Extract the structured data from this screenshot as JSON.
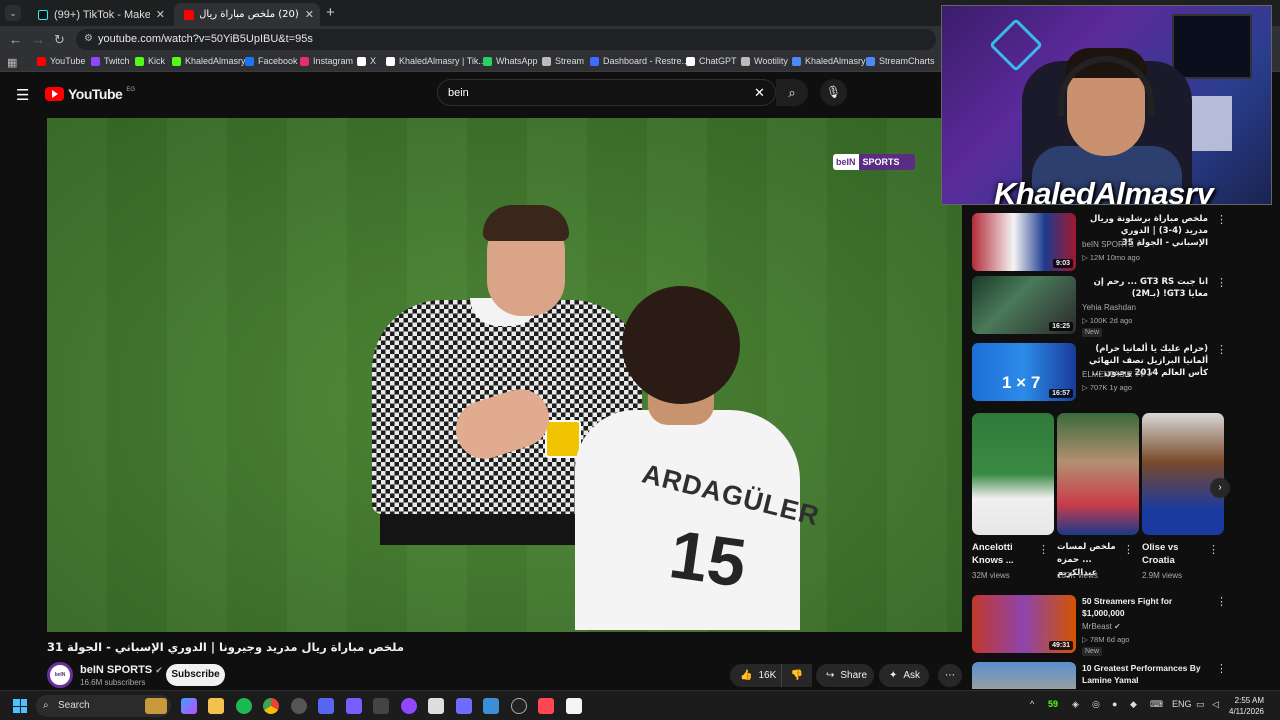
{
  "browser": {
    "tabs": [
      {
        "title": "(99+) TikTok - Make Your Day",
        "icon": "tiktok-icon"
      },
      {
        "title": "(20) ملخص مباراة ريال مدريد و",
        "icon": "youtube-icon"
      }
    ],
    "url": "youtube.com/watch?v=50YiB5UpIBU&t=95s",
    "bookmarks": [
      {
        "label": "YouTube",
        "color": "#ff0000"
      },
      {
        "label": "Twitch",
        "color": "#9146ff"
      },
      {
        "label": "Kick",
        "color": "#53fc18"
      },
      {
        "label": "KhaledAlmasry",
        "color": "#53fc18"
      },
      {
        "label": "Facebook",
        "color": "#1877f2"
      },
      {
        "label": "Instagram",
        "color": "#e1306c"
      },
      {
        "label": "X",
        "color": "#ffffff"
      },
      {
        "label": "KhaledAlmasry | Tik...",
        "color": "#ffffff"
      },
      {
        "label": "WhatsApp",
        "color": "#25d366"
      },
      {
        "label": "Stream",
        "color": "#bbbbbb"
      },
      {
        "label": "Dashboard - Restre...",
        "color": "#3d6bff"
      },
      {
        "label": "ChatGPT",
        "color": "#ffffff"
      },
      {
        "label": "Wootility",
        "color": "#bbbbbb"
      },
      {
        "label": "KhaledAlmasry",
        "color": "#4c8bf5"
      },
      {
        "label": "StreamCharts",
        "color": "#4c8bf5"
      }
    ]
  },
  "youtube": {
    "logo_text": "YouTube",
    "region": "EG",
    "search_query": "bein",
    "video": {
      "title": "ملخص مباراة ريال مدريد وجيرونا | الدوري الإسباني - الجولة 31",
      "overlay_logo": {
        "part1": "beIN",
        "part2": "SPORTS"
      },
      "player_name": "ARDAGÜLER",
      "player_number": "15"
    },
    "channel": {
      "name": "beIN SPORTS",
      "subscribers": "16.6M subscribers",
      "avatar_text": "beIN SPORTS"
    },
    "actions": {
      "subscribe": "Subscribe",
      "likes": "16K",
      "share": "Share",
      "ask": "Ask"
    },
    "recommendations": [
      {
        "title": "ملخص مباراة برشلونة وريال مدريد (4-3) | الدوري الإسباني - الجولة 35",
        "channel": "beIN SPORTS",
        "meta": "▷ 12M  10mo ago",
        "duration": "9:03",
        "verified": true,
        "new": false,
        "rtl": true
      },
      {
        "title": "انا جبت GT3 RS ... رحم إن معايا GT3! (بـ2M)",
        "channel": "Yehia Rashdan",
        "meta": "▷ 100K  2d ago",
        "duration": "16:25",
        "verified": false,
        "new": true,
        "rtl": true
      },
      {
        "title": "(حرام عليك يا ألمانيا حرام) ألمانيا البرازيل نصف النهائي كأس العالم 2014 وجنون ...",
        "channel": "ELMENTASIR TV",
        "meta": "▷ 707K  1y ago",
        "duration": "16:57",
        "verified": true,
        "new": false,
        "rtl": true
      }
    ],
    "shorts": [
      {
        "title": "Ancelotti Knows ...",
        "views": "32M views"
      },
      {
        "title": "ملخص لمسات ... حمزه عبدالكريم",
        "views": "103K views"
      },
      {
        "title": "Olise vs Croatia",
        "views": "2.9M views"
      }
    ],
    "more_recs": [
      {
        "title": "50 Streamers Fight for $1,000,000",
        "channel": "MrBeast",
        "meta": "▷ 78M  6d ago",
        "duration": "49:31",
        "verified": true,
        "new": true
      },
      {
        "title": "10 Greatest Performances By Lamine Yamal",
        "channel": "",
        "meta": "",
        "duration": "",
        "verified": false,
        "new": false
      }
    ],
    "new_badge": "New"
  },
  "webcam": {
    "streamer_name": "KhaledAlmasry"
  },
  "taskbar": {
    "search_label": "Search",
    "badge_count": "59",
    "language": "ENG",
    "time": "2:55 AM",
    "date": "4/11/2026"
  }
}
